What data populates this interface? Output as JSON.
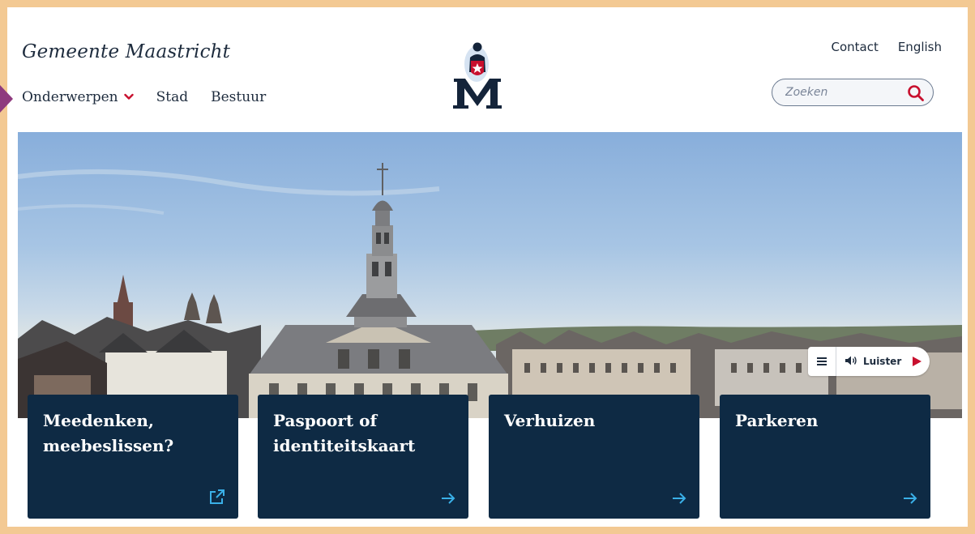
{
  "header": {
    "site_title": "Gemeente Maastricht",
    "utility_links": [
      "Contact",
      "English"
    ],
    "search": {
      "placeholder": "Zoeken"
    }
  },
  "nav": {
    "items": [
      {
        "label": "Onderwerpen",
        "has_dropdown": true
      },
      {
        "label": "Stad"
      },
      {
        "label": "Bestuur"
      }
    ]
  },
  "hero": {
    "image": "Maastricht city hall tower and rooftops",
    "read_aloud": {
      "label": "Luister"
    }
  },
  "cards": [
    {
      "title": "Meedenken, meebeslissen?",
      "icon": "external-link-icon"
    },
    {
      "title": "Paspoort of identiteitskaart",
      "icon": "arrow-right-icon"
    },
    {
      "title": "Verhuizen",
      "icon": "arrow-right-icon"
    },
    {
      "title": "Parkeren",
      "icon": "arrow-right-icon"
    }
  ],
  "colors": {
    "brand_navy": "#0e2a44",
    "brand_red": "#c8102e",
    "accent_link": "#3ab0e8",
    "focus_indicator": "#8e3a7e",
    "page_border": "#f3c993"
  }
}
